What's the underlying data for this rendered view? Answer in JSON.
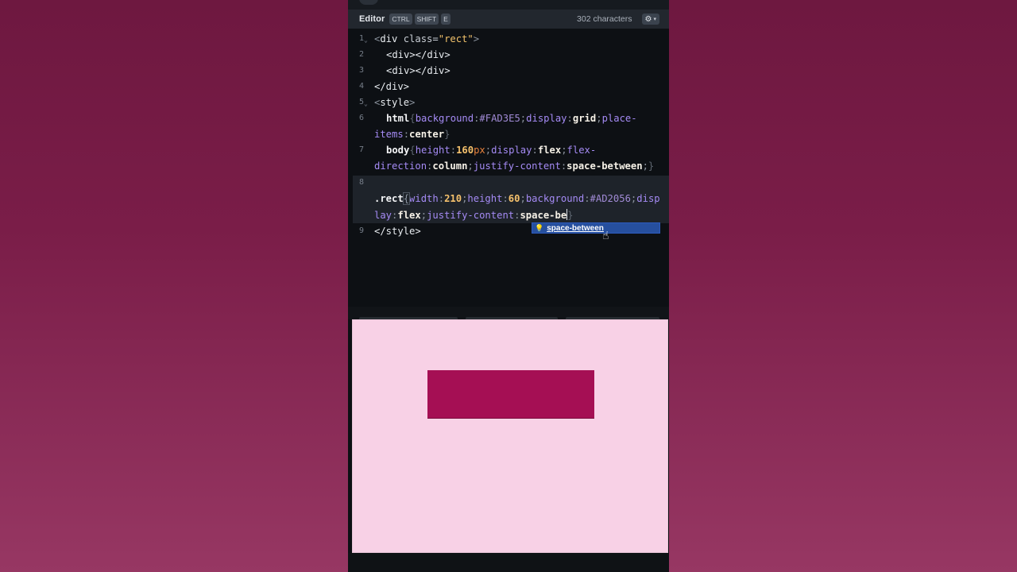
{
  "toolbar": {
    "title": "Editor",
    "shortcut_keys": [
      "CTRL",
      "SHIFT",
      "E"
    ],
    "char_count": "302 characters",
    "settings_icon": "gear-icon"
  },
  "editor": {
    "line_numbers": [
      "1",
      "2",
      "3",
      "4",
      "5",
      "6",
      "7",
      "8",
      "9"
    ],
    "lines": {
      "l1": {
        "open": "<",
        "tag": "div",
        "attr": " class=",
        "str": "\"rect\"",
        "close": ">"
      },
      "l2": {
        "text": "<div></div>"
      },
      "l3": {
        "text": "<div></div>"
      },
      "l4": {
        "text": "</div>"
      },
      "l5": {
        "open": "<",
        "tag": "style",
        "close": ">"
      },
      "l6a": {
        "sel": "html",
        "brace": "{",
        "p1": "background",
        "c1": ":",
        "hex1": "#FAD3E5",
        "s1": ";",
        "p2": "display",
        "c2": ":",
        "v2": "grid",
        "s2": ";",
        "p3": "place-"
      },
      "l6b": {
        "p3b": "items",
        "c3": ":",
        "v3": "center",
        "brace_close": "}"
      },
      "l7a": {
        "sel": "body",
        "brace": "{",
        "p1": "height",
        "c1": ":",
        "n1": "160",
        "u1": "px",
        "s1": ";",
        "p2": "display",
        "c2": ":",
        "v2": "flex",
        "s2": ";",
        "p3": "flex-"
      },
      "l7b": {
        "p3b": "direction",
        "c3": ":",
        "v3": "column",
        "s3": ";",
        "p4": "justify-content",
        "c4": ":",
        "v4": "space-between",
        "s4": ";",
        "brace_close": "}"
      },
      "l8a": {
        "sel": ".rect",
        "brace": "{",
        "p1": "width",
        "c1": ":",
        "n1": "210",
        "s1": ";",
        "p2": "height",
        "c2": ":",
        "n2": "60",
        "s2": ";",
        "p3": "background",
        "c3": ":",
        "hex3": "#AD2056",
        "s3": ";",
        "p4": "disp"
      },
      "l8b": {
        "p4b": "lay",
        "c4": ":",
        "v4": "flex",
        "s4": ";",
        "p5": "justify-content",
        "c5": ":",
        "v5": "space-be",
        "brace_close": "}"
      },
      "l9": {
        "text": "</style>"
      }
    },
    "autocomplete": {
      "option": "space-between",
      "icon": "lightbulb-icon"
    }
  },
  "preview": {
    "background_color": "#F8D1E6",
    "rect_color": "#A50F54"
  }
}
